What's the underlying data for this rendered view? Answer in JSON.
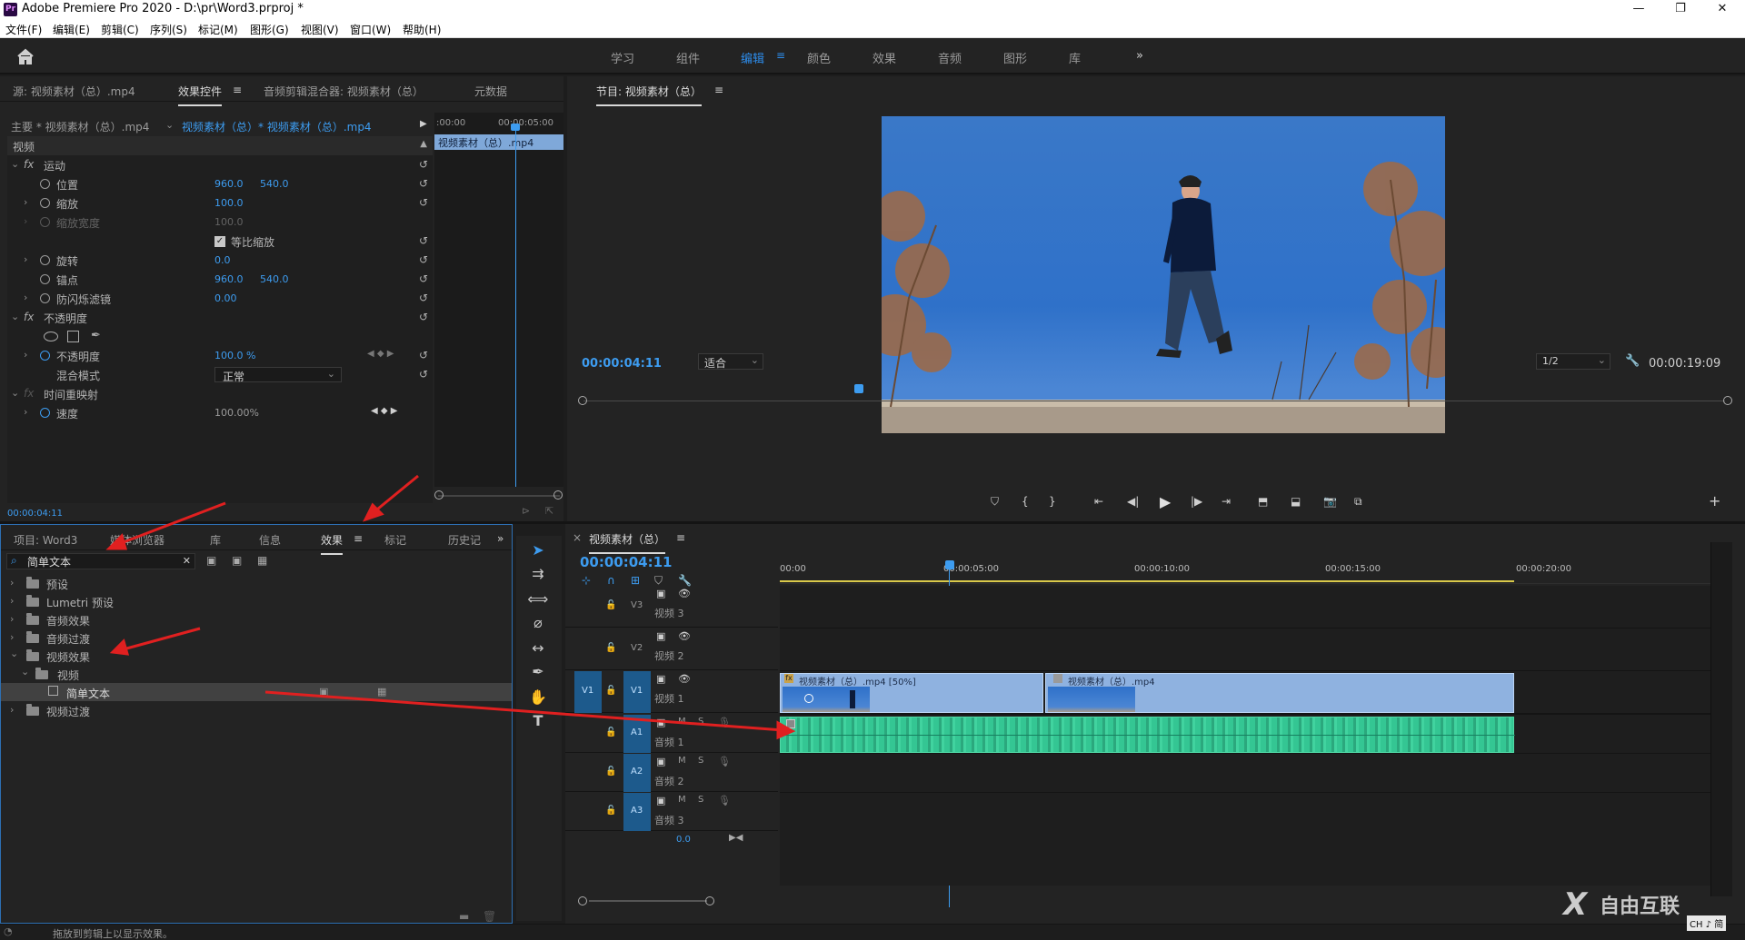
{
  "window": {
    "title": "Adobe Premiere Pro 2020 - D:\\pr\\Word3.prproj *",
    "app_icon": "Pr"
  },
  "menu": [
    "文件(F)",
    "编辑(E)",
    "剪辑(C)",
    "序列(S)",
    "标记(M)",
    "图形(G)",
    "视图(V)",
    "窗口(W)",
    "帮助(H)"
  ],
  "workspaces": [
    "学习",
    "组件",
    "编辑",
    "颜色",
    "效果",
    "音频",
    "图形",
    "库"
  ],
  "workspace_active": "编辑",
  "effect_controls": {
    "tabs": [
      "源: 视频素材（总）.mp4",
      "效果控件",
      "音频剪辑混合器: 视频素材（总）",
      "元数据"
    ],
    "master_label": "主要 * 视频素材（总）.mp4",
    "sequence_label": "视频素材（总）* 视频素材（总）.mp4",
    "ruler_start": ":00:00",
    "ruler_mid": "00:00:05:00",
    "clip_bar": "视频素材（总）.mp4",
    "section_video": "视频",
    "motion": "运动",
    "position": "位置",
    "position_x": "960.0",
    "position_y": "540.0",
    "scale": "缩放",
    "scale_val": "100.0",
    "scale_width": "缩放宽度",
    "scale_width_val": "100.0",
    "uniform_scale": "等比缩放",
    "rotation": "旋转",
    "rotation_val": "0.0",
    "anchor": "锚点",
    "anchor_x": "960.0",
    "anchor_y": "540.0",
    "antiflicker": "防闪烁滤镜",
    "antiflicker_val": "0.00",
    "opacity_section": "不透明度",
    "opacity": "不透明度",
    "opacity_val": "100.0 %",
    "blend_mode": "混合模式",
    "blend_val": "正常",
    "time_remap": "时间重映射",
    "speed": "速度",
    "speed_val": "100.00%",
    "timecode": "00:00:04:11"
  },
  "program": {
    "title": "节目: 视频素材（总）",
    "timecode": "00:00:04:11",
    "fit": "适合",
    "resolution": "1/2",
    "duration": "00:00:19:09"
  },
  "effects_panel": {
    "tabs": [
      "项目: Word3",
      "媒体浏览器",
      "库",
      "信息",
      "效果",
      "标记",
      "历史记"
    ],
    "search_value": "简单文本",
    "tree": [
      {
        "label": "预设",
        "level": 0,
        "open": false
      },
      {
        "label": "Lumetri 预设",
        "level": 0,
        "open": false
      },
      {
        "label": "音频效果",
        "level": 0,
        "open": false
      },
      {
        "label": "音频过渡",
        "level": 0,
        "open": false
      },
      {
        "label": "视频效果",
        "level": 0,
        "open": true
      },
      {
        "label": "视频",
        "level": 1,
        "open": true
      },
      {
        "label": "简单文本",
        "level": 2,
        "open": false,
        "selected": true
      },
      {
        "label": "视频过渡",
        "level": 0,
        "open": false
      }
    ]
  },
  "timeline": {
    "title": "视频素材（总）",
    "timecode": "00:00:04:11",
    "ruler": [
      "00:00",
      "00:00:05:00",
      "00:00:10:00",
      "00:00:15:00",
      "00:00:20:00"
    ],
    "tracks_video": [
      {
        "id": "V3",
        "name": "视频 3"
      },
      {
        "id": "V2",
        "name": "视频 2"
      },
      {
        "id": "V1",
        "name": "视频 1"
      }
    ],
    "tracks_audio": [
      {
        "id": "A1",
        "name": "音频 1"
      },
      {
        "id": "A2",
        "name": "音频 2"
      },
      {
        "id": "A3",
        "name": "音频 3"
      }
    ],
    "clip1": "视频素材（总）.mp4 [50%]",
    "clip2": "视频素材（总）.mp4",
    "zoom_val": "0.0",
    "m_label": "M",
    "s_label": "S"
  },
  "status": "拖放到剪辑上以显示效果。",
  "watermark": {
    "text": "自由互联",
    "ime": "CH ♪ 简"
  }
}
